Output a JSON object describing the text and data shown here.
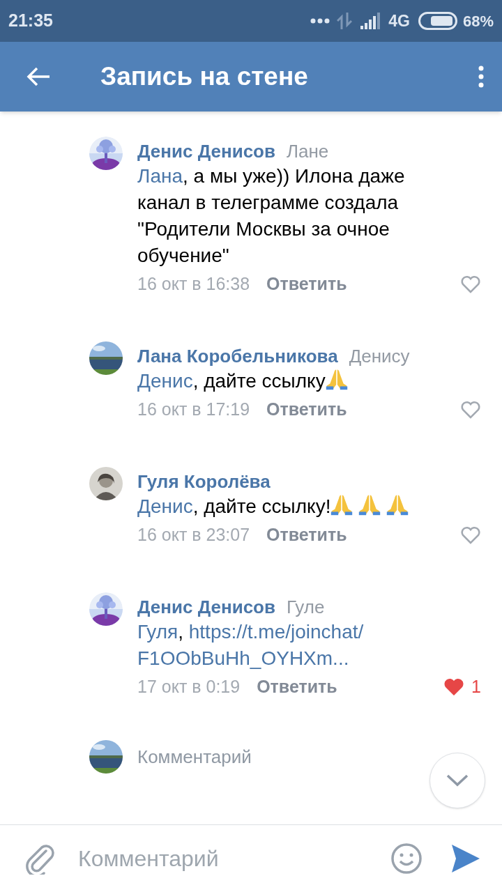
{
  "status_bar": {
    "time": "21:35",
    "network": "4G",
    "battery": "68%"
  },
  "header": {
    "title": "Запись на стене"
  },
  "comments": [
    {
      "avatar": {
        "kind": "tree"
      },
      "author": "Денис Денисов",
      "reply_to": "Лане",
      "parts": [
        {
          "kind": "mention",
          "text": "Лана"
        },
        {
          "kind": "plain",
          "text": ", а мы уже)) Илона даже канал в телеграмме создала \"Родители Москвы за очное обучение\""
        }
      ],
      "time": "16 окт в 16:38",
      "reply_label": "Ответить",
      "liked": false
    },
    {
      "avatar": {
        "kind": "lake"
      },
      "author": "Лана Коробельникова",
      "reply_to": "Денису",
      "parts": [
        {
          "kind": "mention",
          "text": "Денис"
        },
        {
          "kind": "plain",
          "text": ", дайте ссылку"
        }
      ],
      "emojis": [
        {
          "kind": "praying-hands"
        }
      ],
      "time": "16 окт в 17:19",
      "reply_label": "Ответить",
      "liked": false
    },
    {
      "avatar": {
        "kind": "portrait"
      },
      "author": "Гуля Королёва",
      "parts": [
        {
          "kind": "mention",
          "text": "Денис"
        },
        {
          "kind": "plain",
          "text": ", дайте ссылку!"
        }
      ],
      "emojis": [
        {
          "kind": "praying-hands"
        },
        {
          "kind": "praying-hands"
        },
        {
          "kind": "praying-hands"
        }
      ],
      "time": "16 окт в 23:07",
      "reply_label": "Ответить",
      "liked": false
    },
    {
      "avatar": {
        "kind": "tree"
      },
      "author": "Денис Денисов",
      "reply_to": "Гуле",
      "parts": [
        {
          "kind": "mention",
          "text": "Гуля"
        },
        {
          "kind": "plain",
          "text": ", "
        },
        {
          "kind": "link",
          "text": "https://t.me/joinchat/"
        },
        {
          "kind": "link",
          "text": "F1OObBuHh_OYHXm..."
        }
      ],
      "time": "17 окт в 0:19",
      "reply_label": "Ответить",
      "liked": true,
      "like_count": "1"
    }
  ],
  "compose_inline": {
    "avatar": {
      "kind": "lake"
    },
    "placeholder": "Комментарий"
  },
  "input_bar": {
    "placeholder": "Комментарий"
  }
}
